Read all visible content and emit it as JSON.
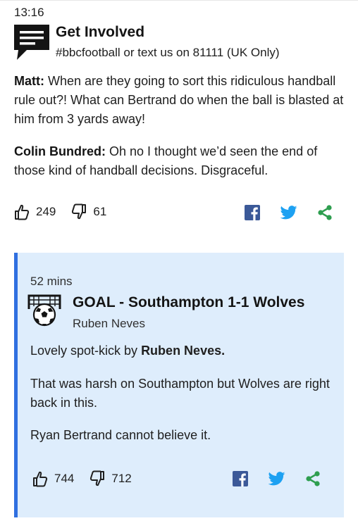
{
  "status_bar": {
    "time": "13:16"
  },
  "get_involved": {
    "title": "Get Involved",
    "subtitle": "#bbcfootball or text us on 81111 (UK Only)",
    "comments": [
      {
        "author": "Matt:",
        "text": " When are they going to sort this ridiculous handball rule out?! What can Bertrand do when the ball is blasted at him from 3 yards away!"
      },
      {
        "author": "Colin Bundred:",
        "text": " Oh no I thought we’d seen the end of those kind of handball decisions. Disgraceful."
      }
    ],
    "likes": "249",
    "dislikes": "61"
  },
  "goal_card": {
    "time": "52 mins",
    "title": "GOAL - Southampton 1-1 Wolves",
    "subtitle": "Ruben Neves",
    "p1_text": "Lovely spot-kick by ",
    "p1_bold": "Ruben Neves.",
    "p2": "That was harsh on Southampton but Wolves are right back in this.",
    "p3": "Ryan Bertrand cannot believe it.",
    "likes": "744",
    "dislikes": "712"
  },
  "icons": {
    "like": "thumbs-up-icon",
    "dislike": "thumbs-down-icon",
    "facebook": "facebook-icon",
    "twitter": "twitter-icon",
    "share": "share-icon",
    "comment": "speech-bubble-icon",
    "goal": "football-goal-icon"
  },
  "colors": {
    "facebook": "#3b5998",
    "twitter": "#1da1f2",
    "share": "#2e9e4f",
    "card_bg": "#deedfc",
    "card_accent": "#2f6fe0"
  }
}
